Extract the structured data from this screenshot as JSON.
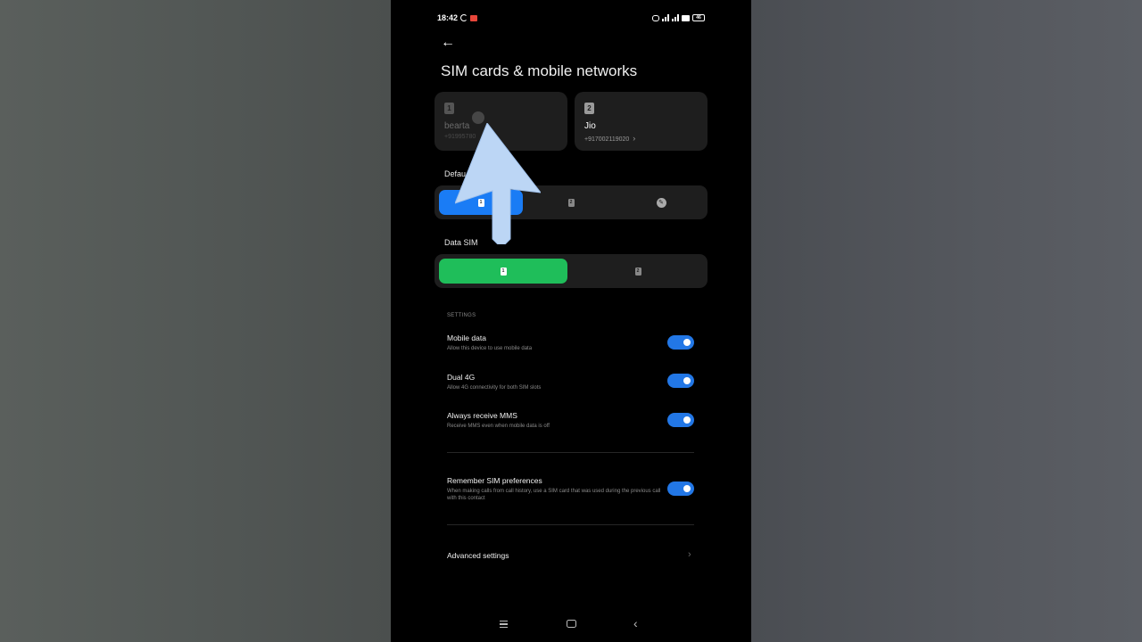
{
  "status": {
    "time": "18:42",
    "battery_label": "46"
  },
  "header": {
    "back_icon": "arrow-left-icon",
    "title": "SIM cards & mobile networks"
  },
  "sims": [
    {
      "slot": "1",
      "name": "bearta",
      "number": "+91995780"
    },
    {
      "slot": "2",
      "name": "Jio",
      "number": "+917002119020",
      "chevron": "›"
    }
  ],
  "default_calls": {
    "label": "Defau",
    "options": [
      "1",
      "2"
    ],
    "ask_icon": "pencil-icon"
  },
  "data_sim": {
    "label": "Data SIM",
    "options": [
      "1",
      "2"
    ]
  },
  "settings": {
    "caption": "SETTINGS",
    "items": [
      {
        "title": "Mobile data",
        "subtitle": "Allow this device to use mobile data",
        "enabled": true
      },
      {
        "title": "Dual 4G",
        "subtitle": "Allow 4G connectivity for both SIM slots",
        "enabled": true
      },
      {
        "title": "Always receive MMS",
        "subtitle": "Receive MMS even when mobile data is off",
        "enabled": true
      }
    ],
    "remember": {
      "title": "Remember SIM preferences",
      "subtitle": "When making calls from call history, use a SIM card that was used during the previous call with this contact",
      "enabled": true
    },
    "advanced": {
      "title": "Advanced settings",
      "chevron": "›"
    }
  },
  "colors": {
    "accent_blue": "#2277e6",
    "data_green": "#22c55e",
    "call_blue": "#1a7cf5",
    "card_bg": "#1e1e1e"
  },
  "nav": {
    "back_glyph": "‹"
  }
}
